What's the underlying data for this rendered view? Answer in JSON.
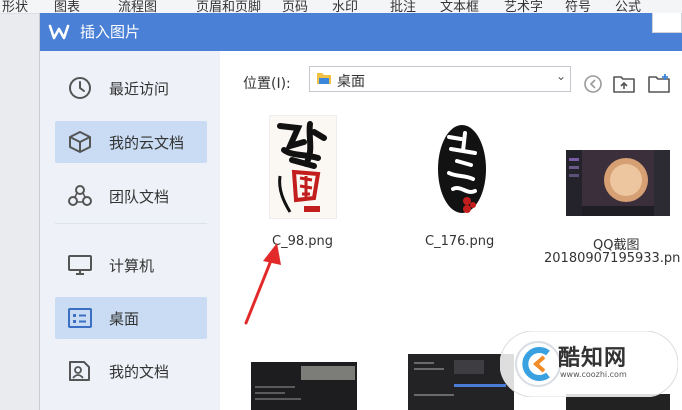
{
  "app_menu": {
    "items": [
      "形状",
      "图表",
      "流程图",
      "页眉和页脚",
      "页码",
      "水印",
      "批注",
      "文本框",
      "艺术字",
      "符号",
      "公式"
    ]
  },
  "dialog": {
    "title": "插入图片",
    "accent_color": "#4a81d6"
  },
  "sidebar": {
    "items": [
      {
        "label": "最近访问",
        "icon": "clock-icon",
        "active": false
      },
      {
        "label": "我的云文档",
        "icon": "cloud-box-icon",
        "active": true
      },
      {
        "label": "团队文档",
        "icon": "team-icon",
        "active": false
      },
      {
        "label": "计算机",
        "icon": "monitor-icon",
        "active": false
      },
      {
        "label": "桌面",
        "icon": "desktop-icon",
        "active": true
      },
      {
        "label": "我的文档",
        "icon": "document-icon",
        "active": false
      }
    ]
  },
  "location": {
    "label": "位置(I):",
    "value": "桌面"
  },
  "files": [
    {
      "name": "C_98.png",
      "icon": "calligraphy-image"
    },
    {
      "name": "C_176.png",
      "icon": "calligraphy-oval-image"
    },
    {
      "name_line1": "QQ截图",
      "name_line2": "20180907195933.pn",
      "icon": "screenshot-thumbnail"
    }
  ],
  "watermark": {
    "name": "酷知网",
    "url": "www.coozhi.com"
  }
}
